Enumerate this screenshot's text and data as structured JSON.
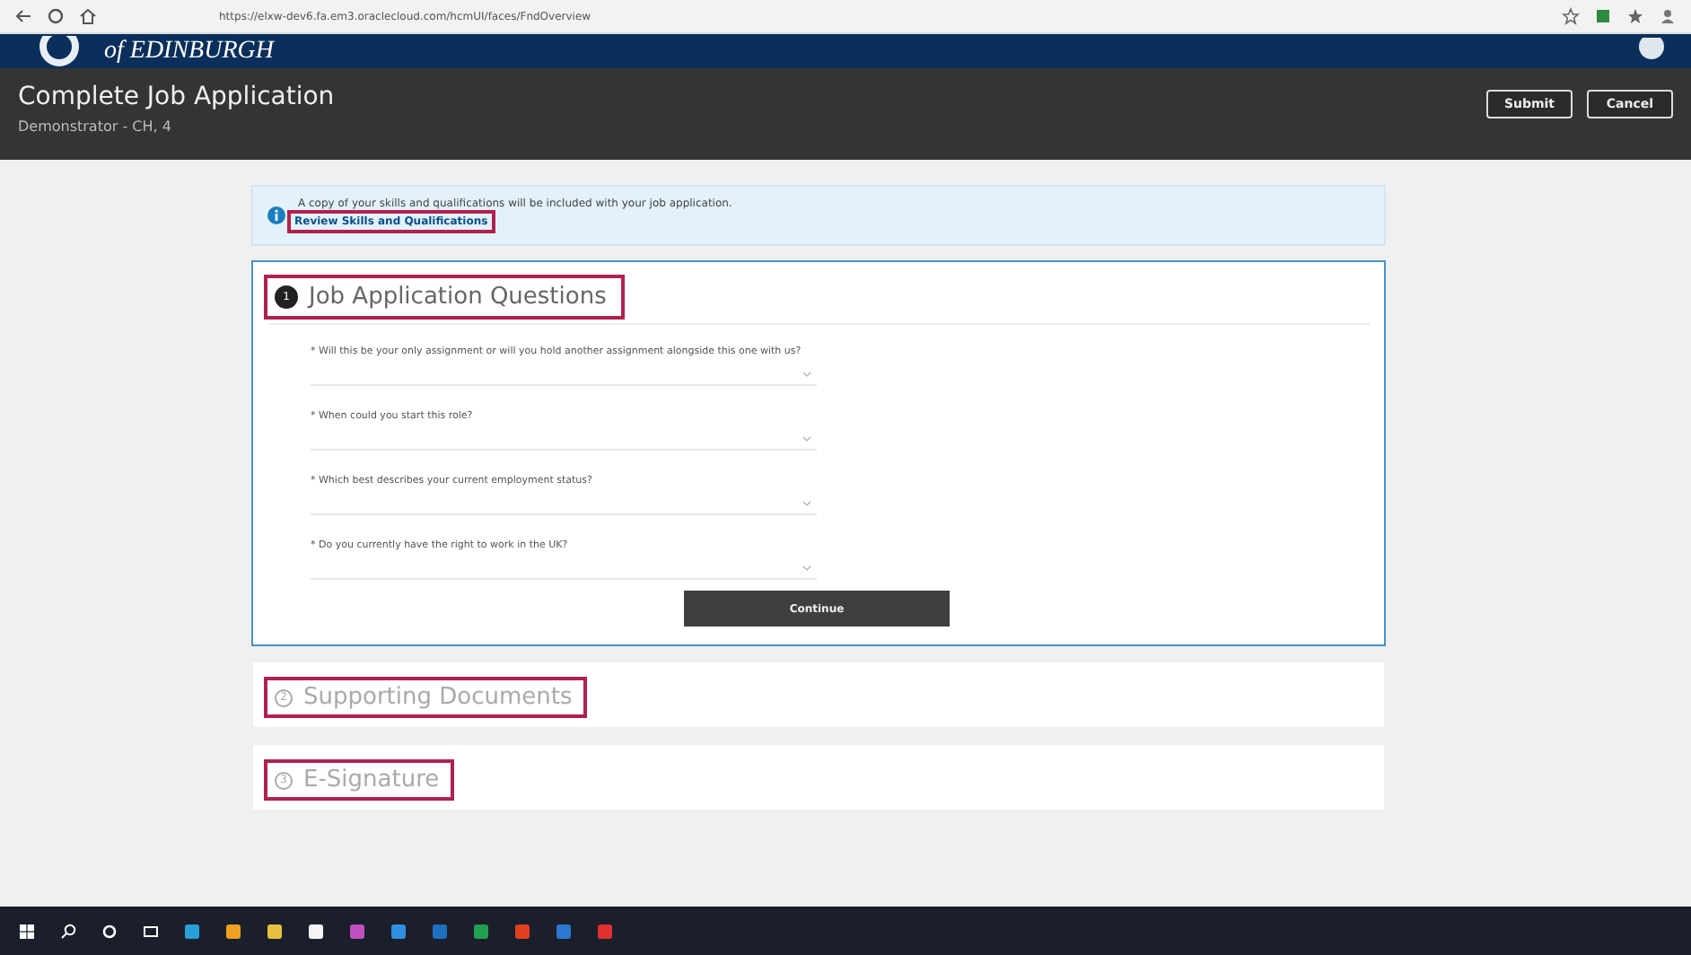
{
  "browser": {
    "url": "https://elxw-dev6.fa.em3.oraclecloud.com/hcmUI/faces/FndOverview"
  },
  "header": {
    "logo_text": "of EDINBURGH"
  },
  "page": {
    "title": "Complete Job Application",
    "subtitle": "Demonstrator - CH, 4",
    "buttons": [
      "Submit",
      "Cancel"
    ]
  },
  "info": {
    "message": "A copy of your skills and qualifications will be included with your job application.",
    "link": "Review Skills and Qualifications",
    "highlighted": true
  },
  "sections": [
    {
      "number": "1",
      "title": "Job Application Questions",
      "expanded": true,
      "highlighted": true,
      "questions": [
        {
          "label": "* Will this be your only assignment or will you hold another assignment alongside this one with us?"
        },
        {
          "label": "* When could you start this role?"
        },
        {
          "label": "* Which best describes your current employment status?"
        },
        {
          "label": "* Do you currently have the right to work in the UK?"
        }
      ],
      "button": "Continue"
    },
    {
      "number": "2",
      "title": "Supporting Documents",
      "expanded": false,
      "highlighted": true
    },
    {
      "number": "3",
      "title": "E-Signature",
      "expanded": false,
      "highlighted": true
    }
  ]
}
